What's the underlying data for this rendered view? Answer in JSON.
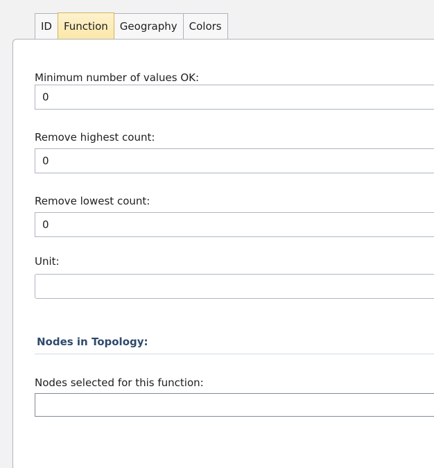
{
  "tabs": [
    {
      "label": "ID"
    },
    {
      "label": "Function",
      "active": true
    },
    {
      "label": "Geography"
    },
    {
      "label": "Colors"
    }
  ],
  "form": {
    "min_values": {
      "label": "Minimum number of values OK:",
      "value": "0"
    },
    "remove_highest": {
      "label": "Remove highest count:",
      "value": "0"
    },
    "remove_lowest": {
      "label": "Remove lowest count:",
      "value": "0"
    },
    "unit": {
      "label": "Unit:",
      "value": ""
    }
  },
  "topology": {
    "section_title": "Nodes in Topology:",
    "nodes_label": "Nodes selected for this function:"
  },
  "colors": {
    "active_tab": "#fbe7a8",
    "section_title": "#2e4a6b"
  }
}
